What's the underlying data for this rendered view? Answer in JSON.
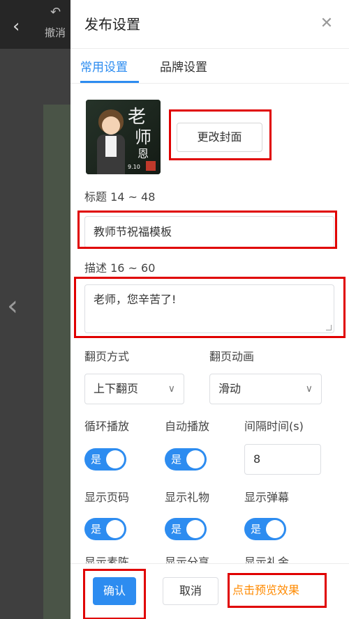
{
  "editor": {
    "undo_label": "撤消"
  },
  "panel": {
    "title": "发布设置",
    "tabs": [
      {
        "label": "常用设置",
        "active": true
      },
      {
        "label": "品牌设置",
        "active": false
      }
    ],
    "cover": {
      "change_button": "更改封面",
      "art_text_1": "老",
      "art_text_2": "师",
      "art_text_3": "恩",
      "art_date": "9.10"
    },
    "title_field": {
      "label": "标题 14 ~ 48",
      "value": "教师节祝福模板"
    },
    "description_field": {
      "label": "描述 16 ~ 60",
      "value": "老师，您辛苦了!"
    },
    "page_turn_mode": {
      "label": "翻页方式",
      "value": "上下翻页"
    },
    "page_turn_animation": {
      "label": "翻页动画",
      "value": "滑动"
    },
    "loop_play": {
      "label": "循环播放",
      "toggle_text": "是",
      "on": true
    },
    "auto_play": {
      "label": "自动播放",
      "toggle_text": "是",
      "on": true
    },
    "interval": {
      "label": "间隔时间(s)",
      "value": "8"
    },
    "show_page_number": {
      "label": "显示页码",
      "toggle_text": "是",
      "on": true
    },
    "show_gifts": {
      "label": "显示礼物",
      "toggle_text": "是",
      "on": true
    },
    "show_danmaku": {
      "label": "显示弹幕",
      "toggle_text": "是",
      "on": true
    },
    "clipped_row": [
      "显示素陈",
      "显示分享",
      "显示礼金"
    ],
    "footer": {
      "confirm": "确认",
      "cancel": "取消",
      "preview": "点击预览效果"
    }
  },
  "colors": {
    "accent": "#2d8cf0",
    "highlight": "#e00000",
    "preview_text": "#ff8a00"
  }
}
